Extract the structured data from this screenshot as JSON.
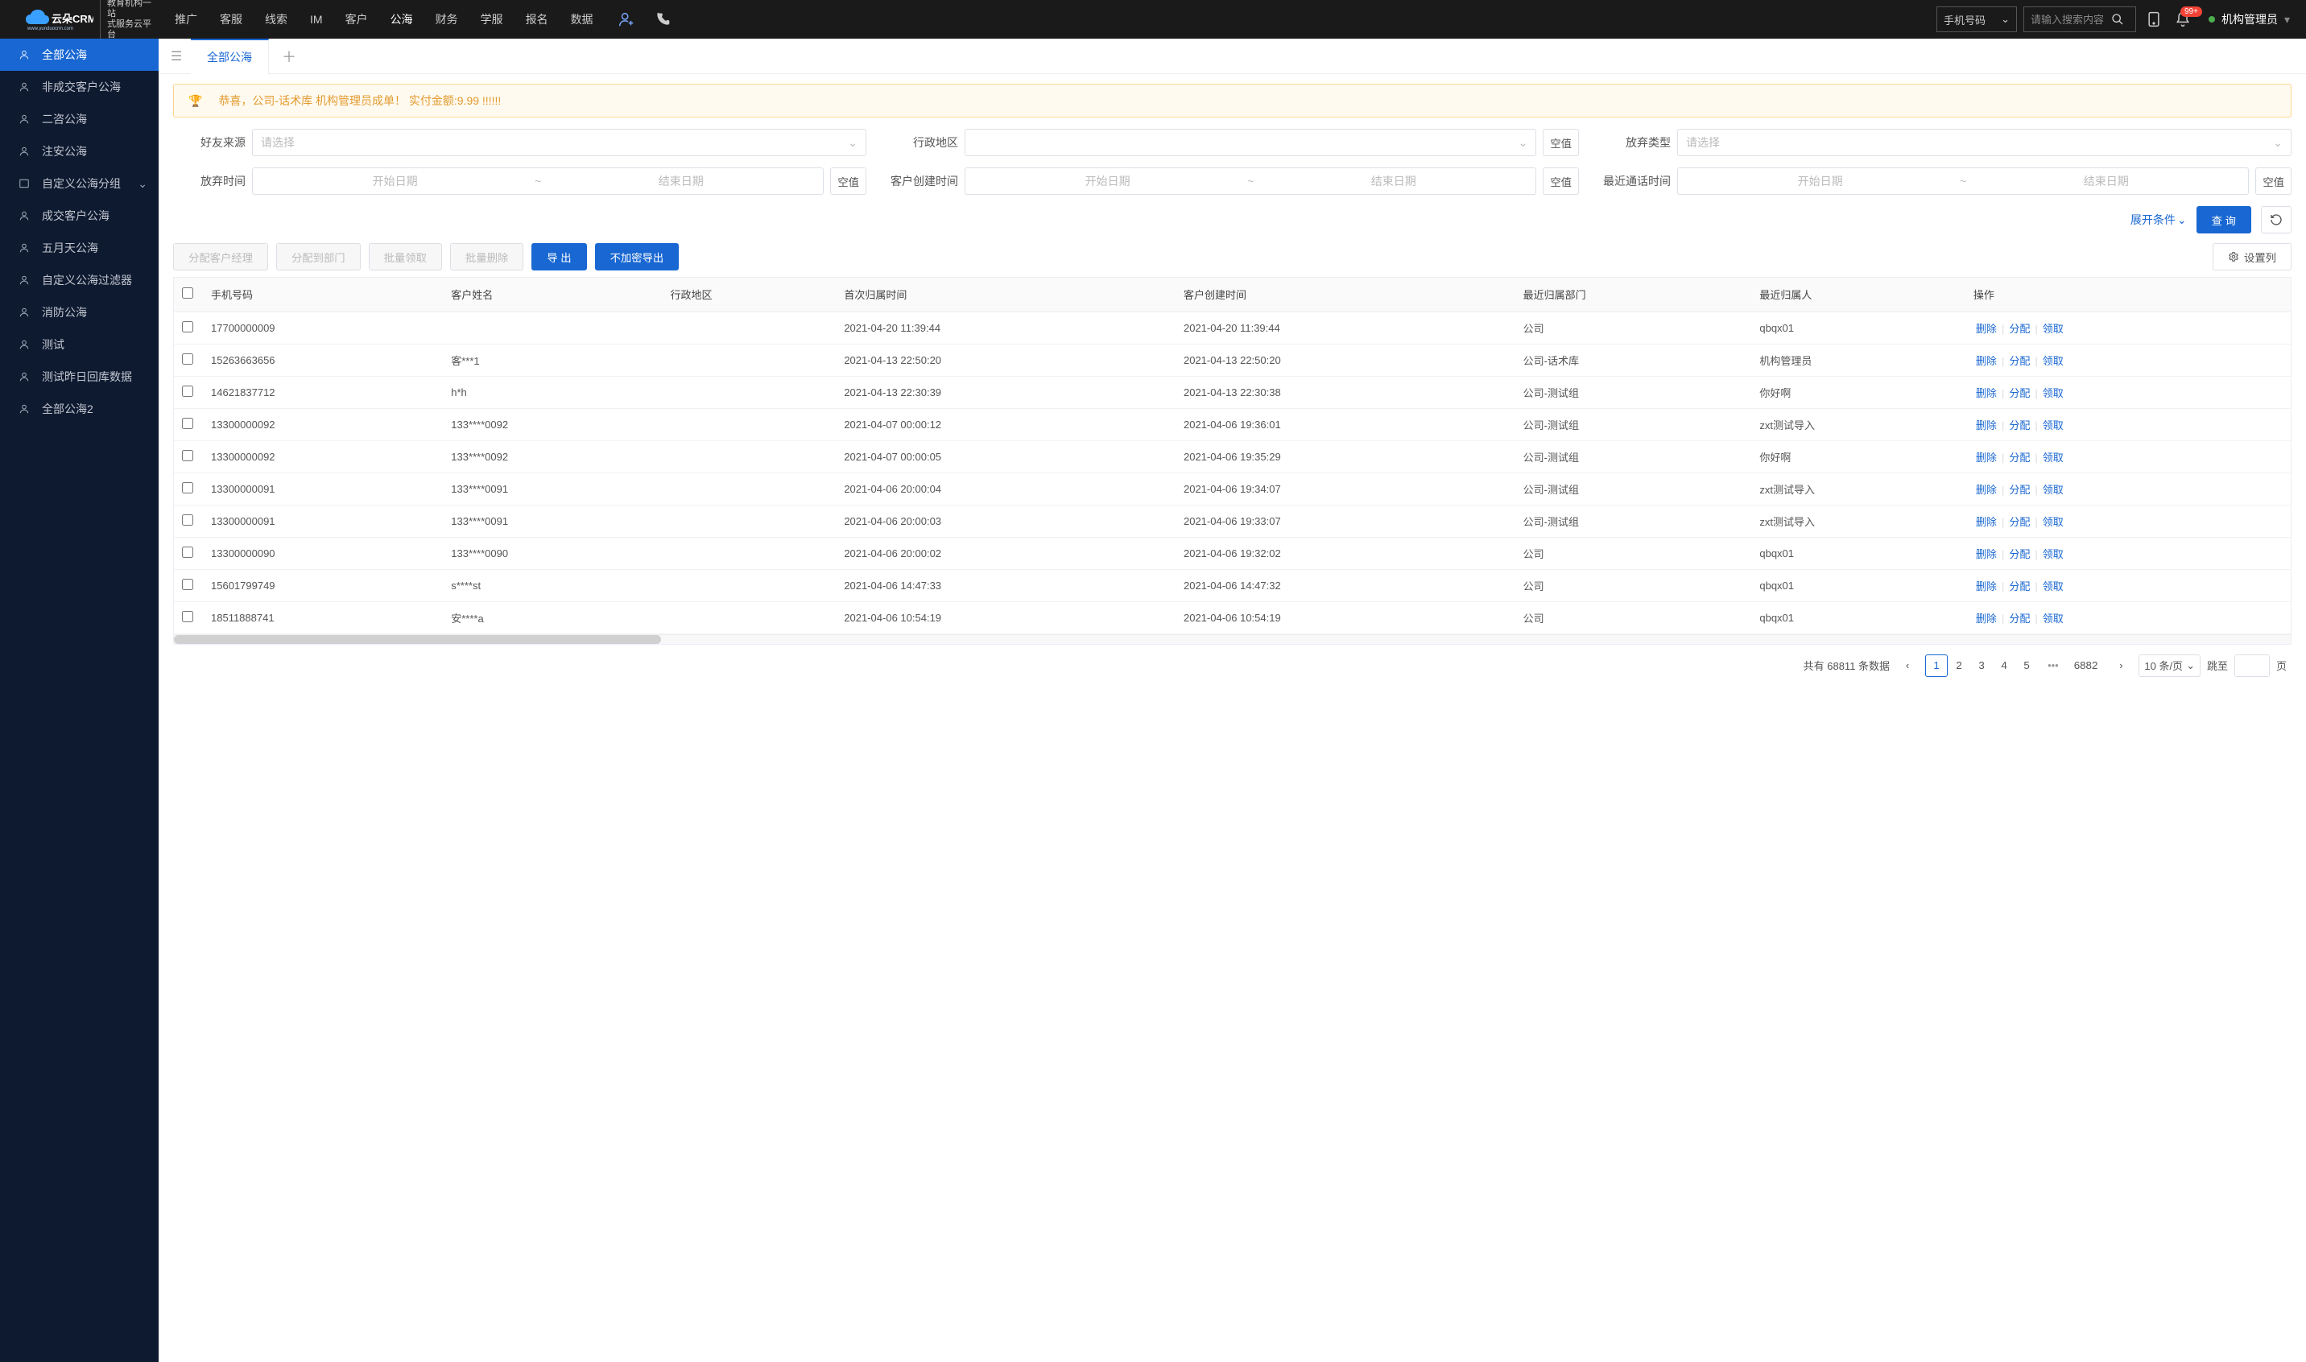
{
  "logo": {
    "brand": "云朵CRM",
    "url": "www.yunduocrm.com",
    "tag1": "教育机构一站",
    "tag2": "式服务云平台"
  },
  "nav": {
    "items": [
      "推广",
      "客服",
      "线索",
      "IM",
      "客户",
      "公海",
      "财务",
      "学服",
      "报名",
      "数据"
    ],
    "active": "公海"
  },
  "topbar": {
    "searchType": "手机号码",
    "searchPlaceholder": "请输入搜索内容",
    "badge": "99+",
    "user": "机构管理员"
  },
  "sidebar": [
    {
      "label": "全部公海",
      "active": true
    },
    {
      "label": "非成交客户公海"
    },
    {
      "label": "二咨公海"
    },
    {
      "label": "注安公海"
    },
    {
      "label": "自定义公海分组",
      "expandable": true
    },
    {
      "label": "成交客户公海"
    },
    {
      "label": "五月天公海"
    },
    {
      "label": "自定义公海过滤器"
    },
    {
      "label": "消防公海"
    },
    {
      "label": "测试"
    },
    {
      "label": "测试昨日回库数据"
    },
    {
      "label": "全部公海2"
    }
  ],
  "tab": {
    "label": "全部公海"
  },
  "alert": {
    "text": "恭喜，公司-话术库  机构管理员成单！  实付金额:9.99 !!!!!!"
  },
  "filters": {
    "friendSource": {
      "label": "好友来源",
      "placeholder": "请选择"
    },
    "adminArea": {
      "label": "行政地区",
      "null": "空值"
    },
    "abandonType": {
      "label": "放弃类型",
      "placeholder": "请选择"
    },
    "abandonTime": {
      "label": "放弃时间",
      "start": "开始日期",
      "end": "结束日期",
      "null": "空值"
    },
    "createTime": {
      "label": "客户创建时间",
      "start": "开始日期",
      "end": "结束日期",
      "null": "空值"
    },
    "lastCall": {
      "label": "最近通话时间",
      "start": "开始日期",
      "end": "结束日期",
      "null": "空值"
    },
    "expand": "展开条件",
    "query": "查 询"
  },
  "toolbar": {
    "assignMgr": "分配客户经理",
    "assignDept": "分配到部门",
    "batchClaim": "批量领取",
    "batchDelete": "批量删除",
    "export": "导 出",
    "exportNoMask": "不加密导出",
    "configCols": "设置列"
  },
  "table": {
    "headers": [
      "手机号码",
      "客户姓名",
      "行政地区",
      "首次归属时间",
      "客户创建时间",
      "最近归属部门",
      "最近归属人",
      "操作"
    ],
    "actions": {
      "delete": "删除",
      "assign": "分配",
      "claim": "领取"
    },
    "rows": [
      {
        "phone": "17700000009",
        "name": "",
        "area": "",
        "first": "2021-04-20 11:39:44",
        "create": "2021-04-20 11:39:44",
        "dept": "公司",
        "owner": "qbqx01"
      },
      {
        "phone": "15263663656",
        "name": "客***1",
        "area": "",
        "first": "2021-04-13 22:50:20",
        "create": "2021-04-13 22:50:20",
        "dept": "公司-话术库",
        "owner": "机构管理员"
      },
      {
        "phone": "14621837712",
        "name": "h*h",
        "area": "",
        "first": "2021-04-13 22:30:39",
        "create": "2021-04-13 22:30:38",
        "dept": "公司-测试组",
        "owner": "你好啊"
      },
      {
        "phone": "13300000092",
        "name": "133****0092",
        "area": "",
        "first": "2021-04-07 00:00:12",
        "create": "2021-04-06 19:36:01",
        "dept": "公司-测试组",
        "owner": "zxt测试导入"
      },
      {
        "phone": "13300000092",
        "name": "133****0092",
        "area": "",
        "first": "2021-04-07 00:00:05",
        "create": "2021-04-06 19:35:29",
        "dept": "公司-测试组",
        "owner": "你好啊"
      },
      {
        "phone": "13300000091",
        "name": "133****0091",
        "area": "",
        "first": "2021-04-06 20:00:04",
        "create": "2021-04-06 19:34:07",
        "dept": "公司-测试组",
        "owner": "zxt测试导入"
      },
      {
        "phone": "13300000091",
        "name": "133****0091",
        "area": "",
        "first": "2021-04-06 20:00:03",
        "create": "2021-04-06 19:33:07",
        "dept": "公司-测试组",
        "owner": "zxt测试导入"
      },
      {
        "phone": "13300000090",
        "name": "133****0090",
        "area": "",
        "first": "2021-04-06 20:00:02",
        "create": "2021-04-06 19:32:02",
        "dept": "公司",
        "owner": "qbqx01"
      },
      {
        "phone": "15601799749",
        "name": "s****st",
        "area": "",
        "first": "2021-04-06 14:47:33",
        "create": "2021-04-06 14:47:32",
        "dept": "公司",
        "owner": "qbqx01"
      },
      {
        "phone": "18511888741",
        "name": "安****a",
        "area": "",
        "first": "2021-04-06 10:54:19",
        "create": "2021-04-06 10:54:19",
        "dept": "公司",
        "owner": "qbqx01"
      }
    ]
  },
  "pagination": {
    "totalPrefix": "共有",
    "total": "68811",
    "totalSuffix": "条数据",
    "pages": [
      "1",
      "2",
      "3",
      "4",
      "5"
    ],
    "lastPage": "6882",
    "perPage": "10 条/页",
    "jumpLabel": "跳至",
    "pageSuffix": "页"
  }
}
